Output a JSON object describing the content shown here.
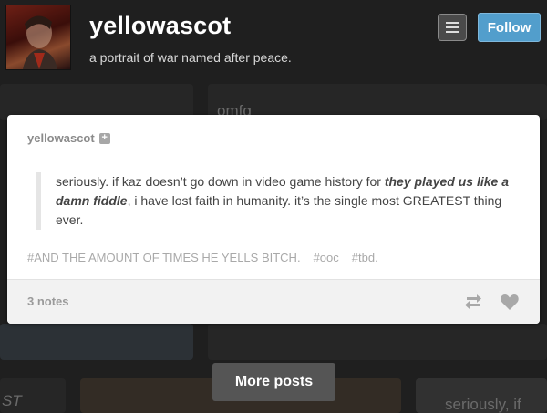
{
  "header": {
    "blog_name": "yellowascot",
    "description": "a portrait of war named after peace.",
    "follow_label": "Follow"
  },
  "background": {
    "peek_text_1": "omfg",
    "peek_text_2": "seriously, if",
    "peek_text_3": "ST"
  },
  "post": {
    "author": "yellowascot",
    "quote_pre": "seriously. if kaz doesn’t go down in video game history for ",
    "quote_bold": "they played us like a damn fiddle",
    "quote_post": ", i have lost faith in humanity. it’s the single most GREATEST thing ever.",
    "tags": [
      "#AND THE AMOUNT OF TIMES HE YELLS BITCH.",
      "#ooc",
      "#tbd."
    ],
    "notes": "3 notes"
  },
  "more_posts_label": "More posts",
  "colors": {
    "follow": "#529ecc",
    "background": "#2d2d2d"
  },
  "icons": {
    "menu": "menu-icon",
    "plus": "plus-icon",
    "reblog": "reblog-icon",
    "like": "heart-icon"
  }
}
